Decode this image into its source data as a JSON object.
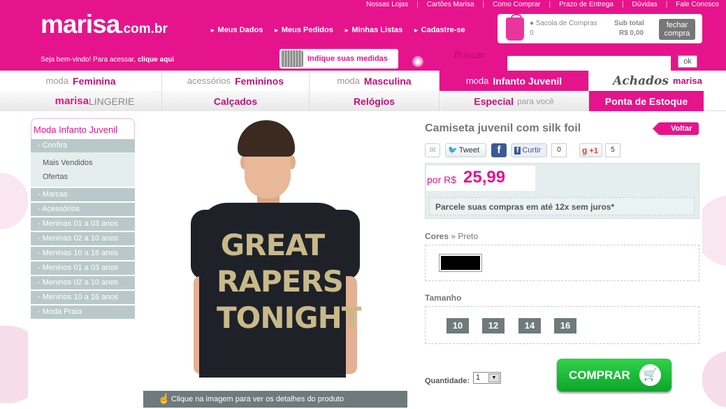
{
  "top_links": [
    "Nossas Lojas",
    "Cartões Marisa",
    "Como Comprar",
    "Prazo de Entrega",
    "Dúvidas",
    "Fale Conosco"
  ],
  "logo": {
    "brand": "marisa",
    "domain": ".com.br"
  },
  "main_nav": [
    "Meus Dados",
    "Meus Pedidos",
    "Minhas Listas",
    "Cadastre-se"
  ],
  "cart": {
    "label": "Sacola de Compras",
    "count": "0",
    "subtotal_label": "Sub total",
    "subtotal": "R$ 0,00",
    "close_label_1": "fechar",
    "close_label_2": "compra"
  },
  "welcome": {
    "text": "Seja bem-vindo! Para acessar, ",
    "link": "clique aqui"
  },
  "medidas_label": "Indique suas medidas",
  "search": {
    "label": "Buscar",
    "button": "ok"
  },
  "categories": [
    {
      "prefix": "moda",
      "name": "Feminina"
    },
    {
      "prefix": "acessórios",
      "name": "Femininos"
    },
    {
      "prefix": "moda",
      "name": "Masculina"
    },
    {
      "prefix": "moda",
      "name": "Infanto Juvenil"
    }
  ],
  "achados": {
    "a": "Achados",
    "b": "marisa"
  },
  "categories2": {
    "lingerie_brand": "marisa",
    "lingerie": "LINGERIE",
    "calcados": "Calçados",
    "relogios": "Relógios",
    "especial": "Especial",
    "especial_sub": "para você",
    "ponta": "Ponta de Estoque"
  },
  "sidebar": {
    "title": "Moda Infanto Juvenil",
    "confira": "- Confira",
    "sub": [
      "Mais Vendidos",
      "Ofertas"
    ],
    "items": [
      "- Marcas",
      "- Acessórios",
      "- Meninas 01 a 03 anos",
      "- Meninas 02 a 10 anos",
      "- Meninas 10 a 16 anos",
      "- Meninos 01 a 03 anos",
      "- Meninos 02 a 10 anos",
      "- Meninos 10 a 16 anos",
      "- Moda Praia"
    ]
  },
  "image": {
    "print_lines": [
      "GREAT",
      "RAPERS",
      "TONIGHT"
    ],
    "caption": "Clique na imagem para ver os detalhes do produto"
  },
  "product": {
    "title": "Camiseta juvenil com silk foil",
    "back": "Voltar",
    "share": {
      "tweet": "Tweet",
      "fb": "f",
      "curtir": "Curtir",
      "curtir_count": "0",
      "gplus": "+1",
      "gplus_count": "5"
    },
    "price_prefix": "por R$",
    "price": "25,99",
    "installments": "Parcele suas compras em até 12x sem juros*",
    "colors_label": "Cores",
    "colors_sep": " » ",
    "color_selected": "Preto",
    "color_hex": "#000000",
    "size_label": "Tamanho",
    "sizes": [
      "10",
      "12",
      "14",
      "16"
    ],
    "qty_label": "Quantidade:",
    "qty": "1",
    "buy": "COMPRAR"
  }
}
